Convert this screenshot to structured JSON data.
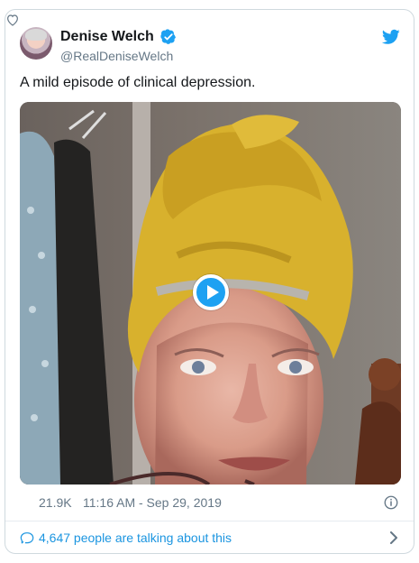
{
  "tweet": {
    "author_name": "Denise Welch",
    "handle": "@RealDeniseWelch",
    "text": "A mild episode of clinical depression.",
    "likes": "21.9K",
    "timestamp": "11:16 AM - Sep 29, 2019",
    "talking": "4,647 people are talking about this"
  },
  "icons": {
    "verified": "verified-badge-icon",
    "brand": "twitter-bird-icon",
    "like": "heart-icon",
    "info": "info-icon",
    "comment": "comment-icon",
    "chevron": "chevron-right-icon",
    "play": "play-icon"
  },
  "colors": {
    "brand_blue": "#1da1f2",
    "link_blue": "#1b95e0",
    "secondary_text": "#657786",
    "border": "#cfd9de",
    "towel_yellow": "#d8b12d"
  }
}
